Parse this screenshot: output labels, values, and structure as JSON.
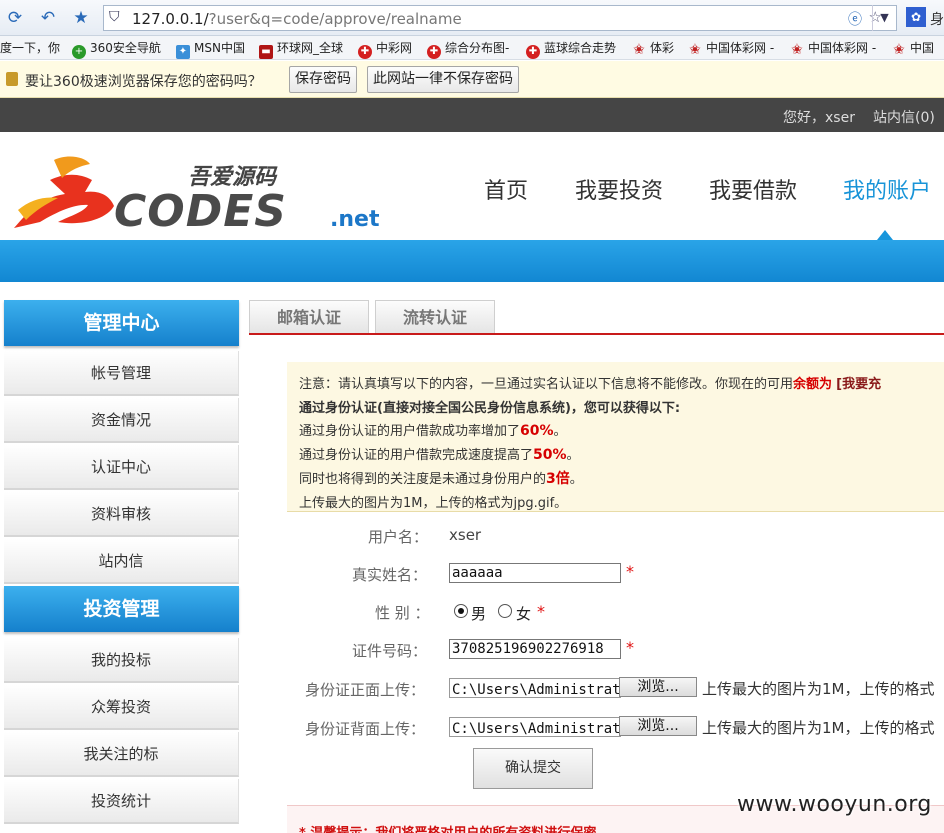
{
  "browser": {
    "url_host": "127.0.0.1/",
    "url_query": "?user&q=code/approve/realname",
    "right_tab_text": "身"
  },
  "bookmarks": [
    {
      "label": "度一下，你",
      "icon": "paw-icon"
    },
    {
      "label": "360安全导航",
      "icon": "360-icon"
    },
    {
      "label": "MSN中国",
      "icon": "msn-icon"
    },
    {
      "label": "环球网_全球",
      "icon": "huanqiu-icon"
    },
    {
      "label": "中彩网",
      "icon": "lottery-icon"
    },
    {
      "label": "综合分布图-",
      "icon": "lottery-icon"
    },
    {
      "label": "蓝球综合走势",
      "icon": "lottery-icon"
    },
    {
      "label": "体彩",
      "icon": "star-icon"
    },
    {
      "label": "中国体彩网 -",
      "icon": "star-icon"
    },
    {
      "label": "中国体彩网 -",
      "icon": "star-icon"
    },
    {
      "label": "中国",
      "icon": "star-icon"
    }
  ],
  "password_bar": {
    "message": "要让360极速浏览器保存您的密码吗？",
    "save_label": "保存密码",
    "never_label": "此网站一律不保存密码"
  },
  "topbar": {
    "greeting": "您好，xser",
    "inbox": "站内信(0)"
  },
  "logo": {
    "cn": "吾爱源码",
    "codes": "CODES",
    "net": ".net"
  },
  "nav": {
    "home": "首页",
    "invest": "我要投资",
    "borrow": "我要借款",
    "account": "我的账户"
  },
  "sidebar": {
    "section1": "管理中心",
    "items1": [
      "帐号管理",
      "资金情况",
      "认证中心",
      "资料审核",
      "站内信"
    ],
    "section2": "投资管理",
    "items2": [
      "我的投标",
      "众筹投资",
      "我关注的标",
      "投资统计"
    ]
  },
  "tabs": {
    "email": "邮箱认证",
    "flow": "流转认证"
  },
  "notice": {
    "line1_a": "注意：请认真填写以下的内容，一旦通过实名认证以下信息将不能修改。你现在的可用",
    "line1_b": "余额为",
    "line1_c": "[我要充",
    "line2": "通过身份认证(直接对接全国公民身份信息系统)，您可以获得以下:",
    "line3_a": "通过身份认证的用户借款成功率增加了",
    "line3_b": "60%",
    "line3_c": "。",
    "line4_a": "通过身份认证的用户借款完成速度提高了",
    "line4_b": "50%",
    "line4_c": "。",
    "line5_a": "同时也将得到的关注度是未通过身份用户的",
    "line5_b": "3倍",
    "line5_c": "。",
    "line6": "上传最大的图片为1M，上传的格式为jpg.gif。"
  },
  "form": {
    "username_label": "用户名：",
    "username_value": "xser",
    "realname_label": "真实姓名：",
    "realname_value": "aaaaaa",
    "gender_label": "性 别 ：",
    "gender_male": "男",
    "gender_female": "女",
    "id_label": "证件号码：",
    "id_value": "370825196902276918",
    "front_label": "身份证正面上传：",
    "back_label": "身份证背面上传：",
    "file_value": "C:\\Users\\Administrator",
    "browse_label": "浏览...",
    "upload_hint": "上传最大的图片为1M，上传的格式",
    "required_mark": "*",
    "submit_label": "确认提交"
  },
  "tip": "* 温馨提示：我们将严格对用户的所有资料进行保密",
  "watermark": "www.wooyun.org"
}
